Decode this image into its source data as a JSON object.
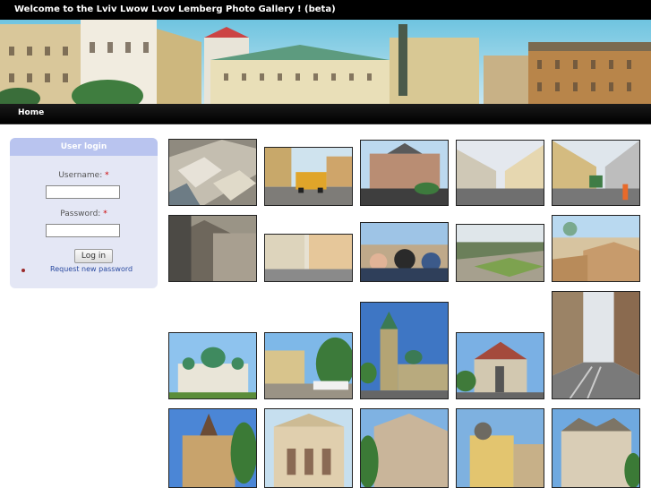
{
  "header": {
    "title": "Welcome to the Lviv Lwow Lvov Lemberg Photo Gallery ! (beta)"
  },
  "nav": {
    "home_label": "Home"
  },
  "login": {
    "title": "User login",
    "username_label": "Username:",
    "password_label": "Password:",
    "required_mark": "*",
    "username_value": "",
    "password_value": "",
    "submit_label": "Log in",
    "request_password_label": "Request new password"
  },
  "gallery": {
    "rows": [
      [
        "aerial-rooftops",
        "yellow-car-street",
        "domed-building-square",
        "wet-street-buildings",
        "tram-street"
      ],
      [
        "courtyard-stairs",
        "building-facades",
        "crowd-street",
        "park-panorama",
        "city-rooftops-view"
      ],
      [
        "green-domed-church",
        "square-with-umbrellas",
        "church-bell-tower",
        "church-with-statue",
        "tram-tracks-street"
      ],
      [
        "ornate-tower-building",
        "baroque-facade",
        "corner-building",
        "yellow-tower-building",
        "rounded-corner-building"
      ]
    ]
  },
  "colors": {
    "accent": "#b9c4ef",
    "panel": "#e4e7f5",
    "link": "#2a4aa0"
  }
}
